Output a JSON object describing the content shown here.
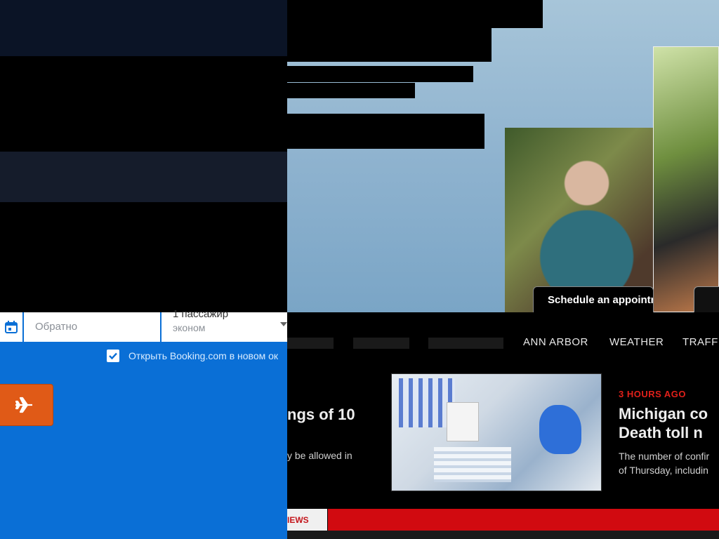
{
  "booking_widget": {
    "return_placeholder": "Обратно",
    "passengers_label": "1 пассажир",
    "cabin_class": "эконом",
    "open_in_new_tab_label": "Открыть Booking.com в новом ок",
    "open_in_new_tab_checked": true,
    "icons": {
      "calendar": "calendar-icon",
      "search": "airplane-icon",
      "caret": "chevron-down-icon"
    },
    "colors": {
      "panel": "#0a6fd6",
      "button": "#e05a17"
    }
  },
  "news_site": {
    "ad": {
      "cta_label": "Schedule an appointm"
    },
    "nav": {
      "items": [
        "ANN ARBOR",
        "WEATHER",
        "TRAFFI"
      ]
    },
    "left_article": {
      "headline_fragment": "ngs of 10",
      "blurb_fragment": "y be allowed in"
    },
    "main_article": {
      "time_ago": "3 HOURS AGO",
      "headline_line1": "Michigan co",
      "headline_line2": "Death toll n",
      "blurb_line1": "The number of confir",
      "blurb_line2": "of Thursday, includin"
    },
    "bottom_tab": "IEWS",
    "colors": {
      "accent_red": "#d10a10",
      "time_red": "#e0201a"
    }
  }
}
